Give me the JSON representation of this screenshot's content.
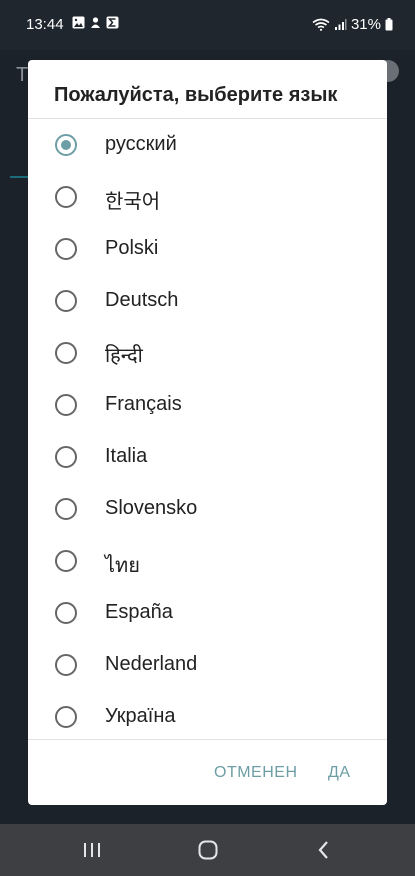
{
  "status_bar": {
    "time": "13:44",
    "battery": "31%",
    "left_icons": [
      "gallery-icon",
      "notification-icon",
      "sigma-app-icon"
    ],
    "right_icons": [
      "wifi-icon",
      "signal-icon",
      "battery-icon"
    ]
  },
  "dialog": {
    "title": "Пожалуйста, выберите язык",
    "selected_index": 0,
    "options": [
      {
        "label": "русский"
      },
      {
        "label": "한국어"
      },
      {
        "label": "Polski"
      },
      {
        "label": "Deutsch"
      },
      {
        "label": "हिन्दी"
      },
      {
        "label": "Français"
      },
      {
        "label": "Italia"
      },
      {
        "label": "Slovensko"
      },
      {
        "label": "ไทย"
      },
      {
        "label": "España"
      },
      {
        "label": "Nederland"
      },
      {
        "label": "Україна"
      }
    ],
    "cancel_label": "ОТМЕНЕН",
    "ok_label": "ДА"
  },
  "background": {
    "hint_letter": "T"
  },
  "colors": {
    "accent": "#6d9ea5",
    "dialog_bg": "#ffffff",
    "scrim": "#1b2229",
    "navbar": "#3d3f43"
  }
}
